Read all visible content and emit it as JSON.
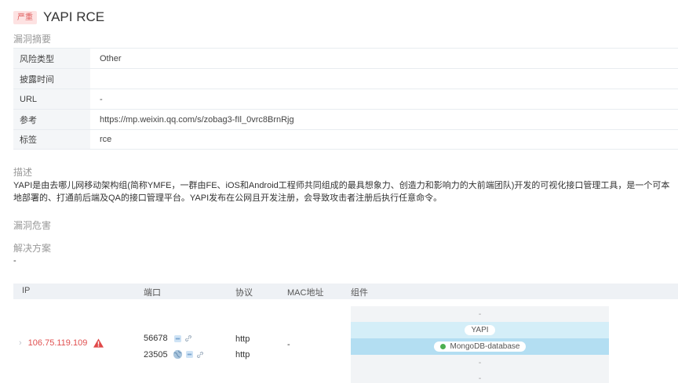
{
  "header": {
    "severity": "严重",
    "title": "YAPI RCE"
  },
  "summary": {
    "label": "漏洞摘要",
    "rows": [
      {
        "key": "风险类型",
        "value": "Other"
      },
      {
        "key": "披露时间",
        "value": ""
      },
      {
        "key": "URL",
        "value": "-"
      },
      {
        "key": "参考",
        "value": "https://mp.weixin.qq.com/s/zobag3-fIl_0vrc8BrnRjg"
      },
      {
        "key": "标签",
        "value": "rce"
      }
    ]
  },
  "description": {
    "label": "描述",
    "text": "YAPI是由去哪儿网移动架构组(简称YMFE，一群由FE、iOS和Android工程师共同组成的最具想象力、创造力和影响力的大前端团队)开发的可视化接口管理工具，是一个可本地部署的、打通前后端及QA的接口管理平台。YAPI发布在公网且开发注册，会导致攻击者注册后执行任意命令。"
  },
  "impact": {
    "label": "漏洞危害"
  },
  "solution": {
    "label": "解决方案",
    "value": "-"
  },
  "assets": {
    "columns": {
      "ip": "IP",
      "port": "端口",
      "protocol": "协议",
      "mac": "MAC地址",
      "component": "组件"
    },
    "row": {
      "ip": "106.75.119.109",
      "ports": [
        {
          "port": "56678",
          "protocol": "http"
        },
        {
          "port": "23505",
          "protocol": "http"
        }
      ],
      "mac": "-",
      "components": [
        "-",
        "YAPI",
        "MongoDB-database",
        "-",
        "-"
      ]
    }
  },
  "colors": {
    "accent_red": "#e05050",
    "badge_bg": "#fde2e2",
    "component_light": "#d4eef8",
    "component_mid": "#b3def2"
  }
}
